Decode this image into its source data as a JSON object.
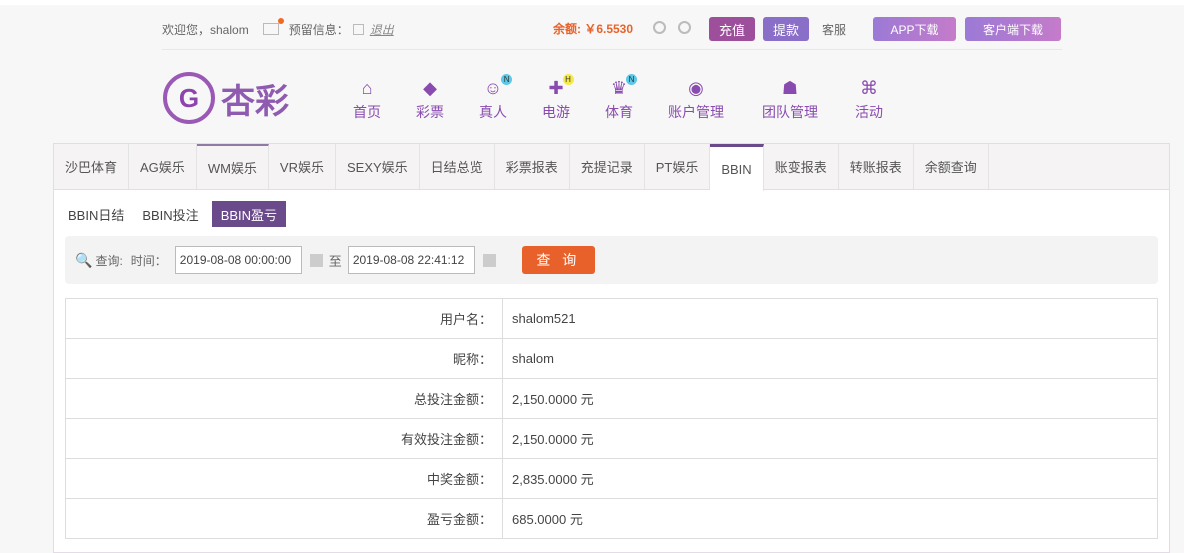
{
  "top": {
    "welcome": "欢迎您，shalom",
    "reserve": "预留信息：",
    "logout": "退出",
    "balance": "余额: ￥6.5530",
    "deposit": "充值",
    "withdraw": "提款",
    "service": "客服",
    "app": "APP下载",
    "client": "客户端下载"
  },
  "logo": {
    "mark": "G",
    "name": "杏彩"
  },
  "nav": [
    {
      "icon": "⌂",
      "label": "首页"
    },
    {
      "icon": "◆",
      "label": "彩票"
    },
    {
      "icon": "☺",
      "label": "真人",
      "badge": "N"
    },
    {
      "icon": "✚",
      "label": "电游",
      "badge": "H"
    },
    {
      "icon": "♛",
      "label": "体育",
      "badge": "N"
    },
    {
      "icon": "◉",
      "label": "账户管理"
    },
    {
      "icon": "☗",
      "label": "团队管理"
    },
    {
      "icon": "⌘",
      "label": "活动"
    }
  ],
  "tabs": [
    "沙巴体育",
    "AG娱乐",
    "WM娱乐",
    "VR娱乐",
    "SEXY娱乐",
    "日结总览",
    "彩票报表",
    "充提记录",
    "PT娱乐",
    "BBIN",
    "账变报表",
    "转账报表",
    "余额查询"
  ],
  "subtabs": [
    "BBIN日结",
    "BBIN投注",
    "BBIN盈亏"
  ],
  "query": {
    "label": "查询:",
    "time": "时间：",
    "from": "2019-08-08 00:00:00",
    "to_label": "至",
    "to": "2019-08-08 22:41:12",
    "button": "查 询"
  },
  "rows": [
    {
      "k": "用户名：",
      "v": "shalom521"
    },
    {
      "k": "昵称：",
      "v": "shalom"
    },
    {
      "k": "总投注金额：",
      "v": "2,150.0000 元"
    },
    {
      "k": "有效投注金额：",
      "v": "2,150.0000 元"
    },
    {
      "k": "中奖金额：",
      "v": "2,835.0000 元"
    },
    {
      "k": "盈亏金额：",
      "v": "685.0000 元"
    }
  ]
}
